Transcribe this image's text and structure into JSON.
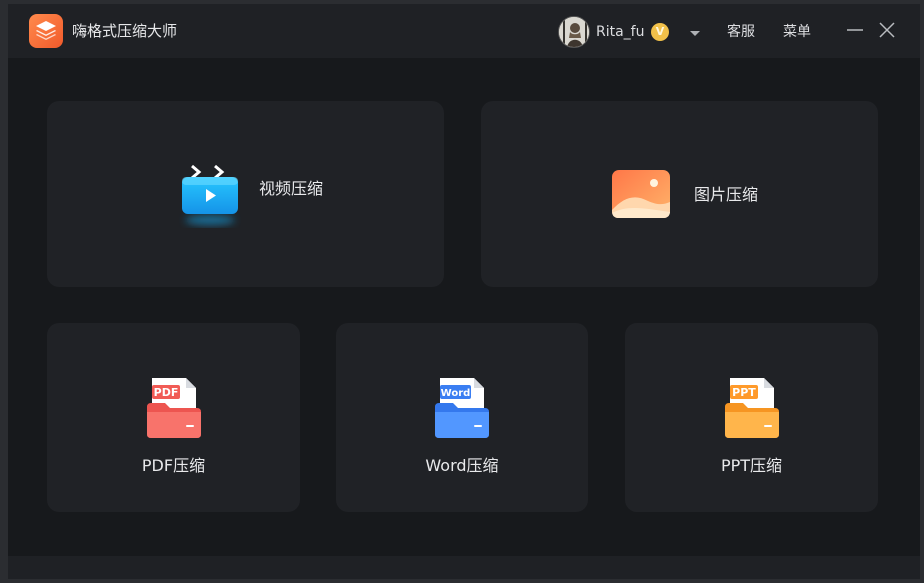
{
  "app": {
    "title": "嗨格式压缩大师",
    "logo_icon": "layers-icon",
    "accent": "#f26a35"
  },
  "header": {
    "username": "Rita_fu",
    "vip_badge": "V",
    "dropdown_icon": "chevron-down-icon",
    "support_label": "客服",
    "menu_label": "菜单",
    "minimize_icon": "minimize-icon",
    "close_icon": "close-icon"
  },
  "tools": {
    "video": {
      "label": "视频压缩",
      "icon": "video-compress-icon",
      "color": "#20b8f5"
    },
    "image": {
      "label": "图片压缩",
      "icon": "image-compress-icon",
      "color": "#ff9a55"
    },
    "pdf": {
      "label": "PDF压缩",
      "icon": "pdf-folder-icon",
      "badge": "PDF",
      "color": "#f05c54"
    },
    "word": {
      "label": "Word压缩",
      "icon": "word-folder-icon",
      "badge": "Word",
      "color": "#3b80f0"
    },
    "ppt": {
      "label": "PPT压缩",
      "icon": "ppt-folder-icon",
      "badge": "PPT",
      "color": "#fca02d"
    }
  }
}
